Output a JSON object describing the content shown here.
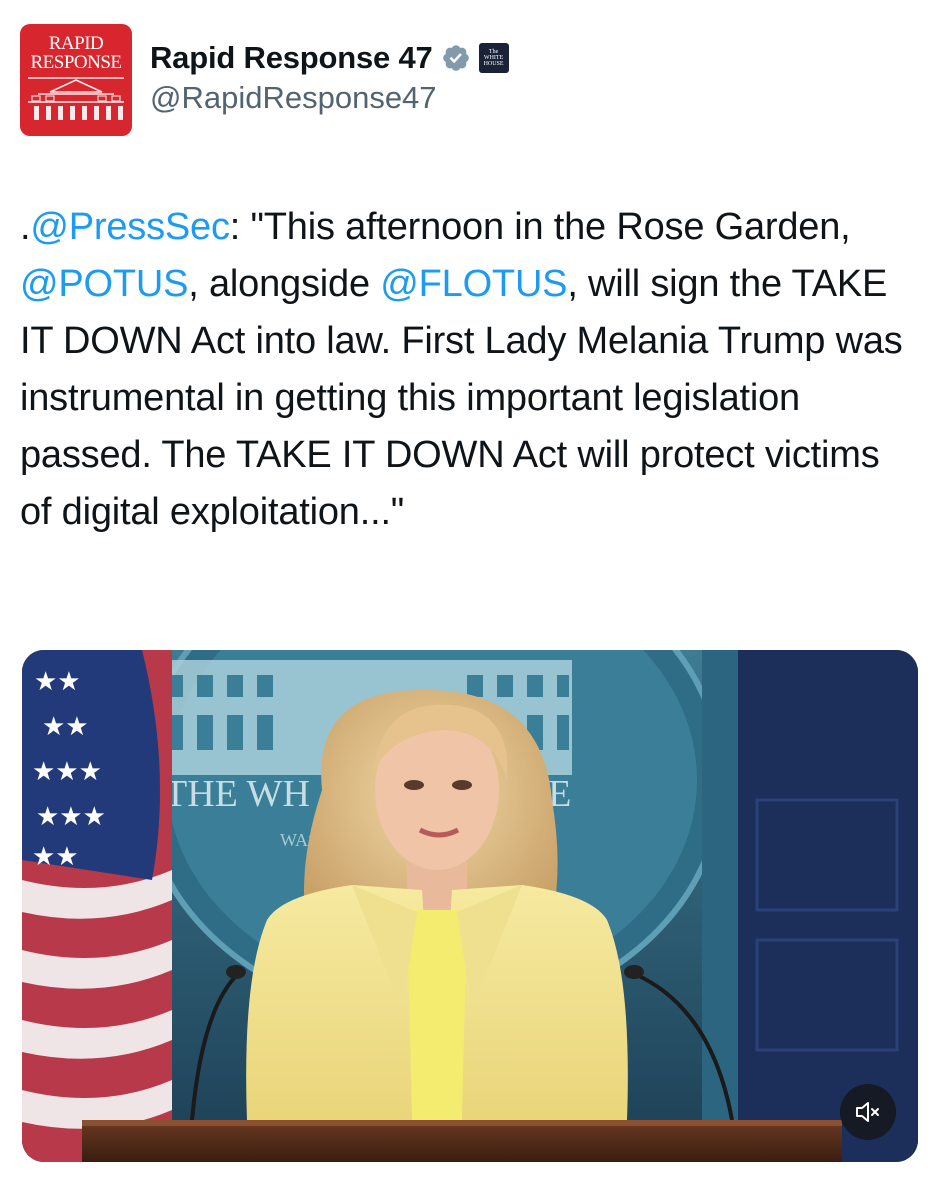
{
  "account": {
    "display_name": "Rapid Response 47",
    "handle": "@RapidResponse47",
    "avatar_text": "RAPID\nRESPONSE",
    "avatar_color": "#d8262e",
    "verified_icon": "verified-badge-icon",
    "affiliate_badge_text": "The\nWHITE\nHOUSE"
  },
  "tweet": {
    "segments": [
      {
        "text": ".",
        "type": "text"
      },
      {
        "text": "@PressSec",
        "type": "mention"
      },
      {
        "text": ": \"This afternoon in the Rose Garden, ",
        "type": "text"
      },
      {
        "text": "@POTUS",
        "type": "mention"
      },
      {
        "text": ", alongside ",
        "type": "text"
      },
      {
        "text": "@FLOTUS",
        "type": "mention"
      },
      {
        "text": ", will sign the TAKE IT DOWN Act into law. First Lady Melania Trump was instrumental in getting this important legislation passed. The TAKE IT DOWN Act will protect victims of digital exploitation...\"",
        "type": "text"
      }
    ]
  },
  "media": {
    "type": "video",
    "backdrop_text_left": "THE WH",
    "backdrop_text_right": "SE",
    "backdrop_subtext": "WAS",
    "mute_icon": "speaker-muted-icon"
  },
  "colors": {
    "link": "#1d9bf0",
    "text": "#0f1419",
    "secondary": "#536471"
  }
}
